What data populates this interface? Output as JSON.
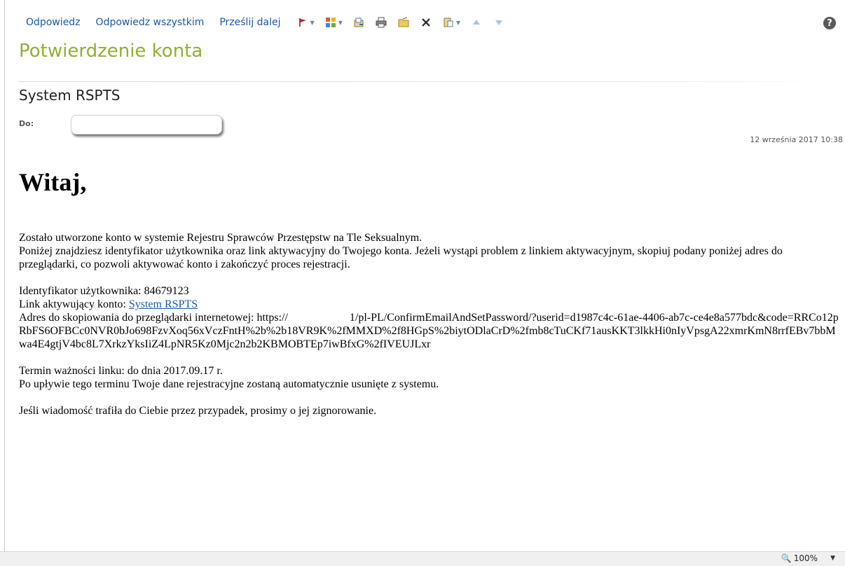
{
  "toolbar": {
    "reply": "Odpowiedz",
    "reply_all": "Odpowiedz wszystkim",
    "forward": "Prześlij dalej"
  },
  "icons": {
    "flag": "flag-icon",
    "categorize": "categorize-icon",
    "move": "move-icon",
    "print": "print-icon",
    "open_folder": "folder-icon",
    "delete": "delete-icon",
    "copy": "clipboard-icon",
    "up": "up-arrow-icon",
    "down": "down-arrow-icon",
    "help": "help-icon"
  },
  "colors": {
    "accent": "#8fb130",
    "link": "#1a5aa6",
    "flag": "#c0112b"
  },
  "message": {
    "subject": "Potwierdzenie konta",
    "sender": "System RSPTS",
    "to_label": "Do:",
    "to_value": "",
    "date": "12 września 2017 10:38",
    "greeting": "Witaj,",
    "para1_line1": "Zostało utworzone konto w systemie Rejestru Sprawców Przestępstw na Tle Seksualnym.",
    "para1_line2": "Poniżej znajdziesz identyfikator użytkownika oraz link aktywacyjny do Twojego konta. Jeżeli wystąpi problem z linkiem aktywacyjnym, skopiuj podany poniżej adres do przeglądarki, co pozwoli aktywować konto i zakończyć proces rejestracji.",
    "user_id_label": "Identyfikator użytkownika: 84679123",
    "link_label": "Link aktywujący konto: ",
    "link_text": "System RSPTS",
    "address_prefix": "Adres do skopiowania do przeglądarki internetowej: https://",
    "address_suffix": "1/pl-PL/ConfirmEmailAndSetPassword/?userid=d1987c4c-61ae-4406-ab7c-ce4e8a577bdc&code=RRCo12pRbFS6OFBCc0NVR0bJo698FzvXoq56xVczFntH%2b%2b18VR9K%2fMMXD%2f8HGpS%2biytODlaCrD%2fmb8cTuCKf71ausKKT3lkkHi0nIyVpsgA22xmrKmN8rrfEBv7bbMwa4E4gtjV4bc8L7XrkzYksIiZ4LpNR5Kz0Mjc2n2b2KBMOBTEp7iwBfxG%2fIVEUJLxr",
    "expiry": "Termin ważności linku: do dnia 2017.09.17 r.",
    "expiry_note": "Po upływie tego terminu Twoje dane rejestracyjne zostaną automatycznie usunięte z systemu.",
    "ignore_note": "Jeśli wiadomość trafiła do Ciebie przez przypadek, prosimy o jej zignorowanie."
  },
  "status": {
    "zoom": "100%"
  }
}
